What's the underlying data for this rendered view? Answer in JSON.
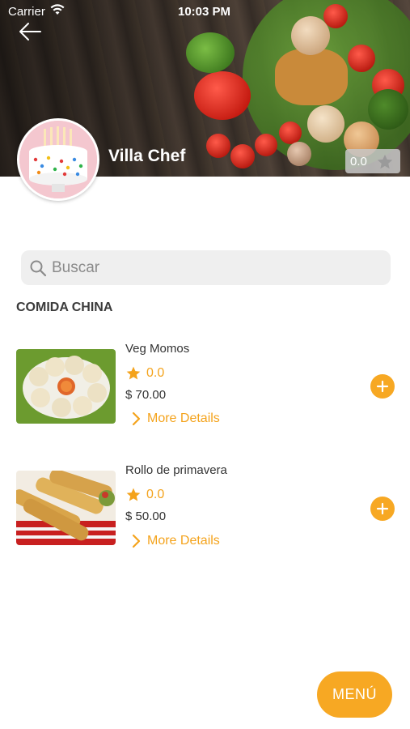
{
  "status_bar": {
    "carrier": "Carrier",
    "time": "10:03 PM"
  },
  "chef": {
    "name": "Villa Chef",
    "rating": "0.0"
  },
  "search": {
    "placeholder": "Buscar"
  },
  "category": {
    "title": "COMIDA CHINA"
  },
  "items": [
    {
      "name": "Veg Momos",
      "rating": "0.0",
      "price": "$ 70.00",
      "details_label": "More Details"
    },
    {
      "name": "Rollo de primavera",
      "rating": "0.0",
      "price": "$ 50.00",
      "details_label": "More Details"
    }
  ],
  "menu_button": {
    "label": "MENÚ"
  },
  "colors": {
    "accent": "#f7a823",
    "text": "#333333",
    "search_bg": "#efefef"
  },
  "icons": [
    "back-arrow-icon",
    "wifi-icon",
    "star-icon",
    "search-icon",
    "chevron-right-icon",
    "plus-icon"
  ]
}
